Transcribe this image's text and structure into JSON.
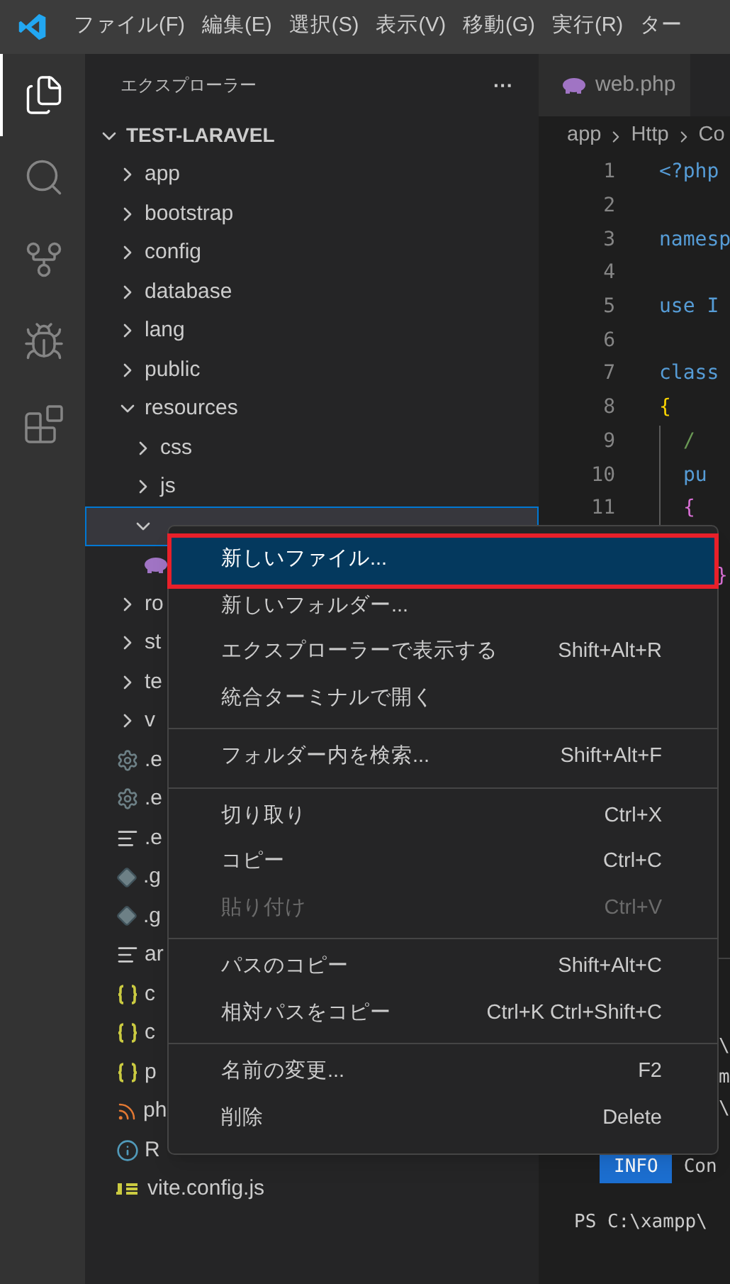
{
  "menu_bar": {
    "items": [
      "ファイル(F)",
      "編集(E)",
      "選択(S)",
      "表示(V)",
      "移動(G)",
      "実行(R)",
      "ター"
    ]
  },
  "activity_bar": {
    "items": [
      {
        "kind": "files",
        "selected": true
      },
      {
        "kind": "search",
        "selected": false
      },
      {
        "kind": "branch",
        "selected": false
      },
      {
        "kind": "debug",
        "selected": false
      },
      {
        "kind": "extensions",
        "selected": false
      }
    ]
  },
  "explorer": {
    "title": "エクスプローラー",
    "more": "···",
    "tree": [
      {
        "label": "TEST-LARAVEL",
        "kind": "root",
        "expanded": true,
        "children": [
          {
            "label": "app",
            "kind": "folder",
            "expanded": false
          },
          {
            "label": "bootstrap",
            "kind": "folder",
            "expanded": false
          },
          {
            "label": "config",
            "kind": "folder",
            "expanded": false
          },
          {
            "label": "database",
            "kind": "folder",
            "expanded": false
          },
          {
            "label": "lang",
            "kind": "folder",
            "expanded": false
          },
          {
            "label": "public",
            "kind": "folder",
            "expanded": false
          },
          {
            "label": "resources",
            "kind": "folder",
            "expanded": true,
            "children": [
              {
                "label": "css",
                "kind": "folder",
                "expanded": false
              },
              {
                "label": "js",
                "kind": "folder",
                "expanded": false
              },
              {
                "kind": "folder",
                "expanded": true,
                "selected": true,
                "children": [
                  {
                    "kind": "php"
                  }
                ]
              }
            ]
          },
          {
            "label": "ro",
            "kind": "folder",
            "expanded": false
          },
          {
            "label": "st",
            "kind": "folder",
            "expanded": false
          },
          {
            "label": "te",
            "kind": "folder",
            "expanded": false
          },
          {
            "label": "v",
            "kind": "folder",
            "expanded": false
          },
          {
            "label": ".e",
            "kind": "gear"
          },
          {
            "label": ".e",
            "kind": "gear"
          },
          {
            "label": ".e",
            "kind": "lines"
          },
          {
            "label": ".g",
            "kind": "git"
          },
          {
            "label": ".g",
            "kind": "git"
          },
          {
            "label": "ar",
            "kind": "lines"
          },
          {
            "label": "c",
            "kind": "json"
          },
          {
            "label": "c",
            "kind": "json"
          },
          {
            "label": "p",
            "kind": "json"
          },
          {
            "label": "ph",
            "kind": "rss"
          },
          {
            "label": "R",
            "kind": "info"
          },
          {
            "label": "vite.config.js",
            "kind": "js"
          }
        ]
      }
    ]
  },
  "editor": {
    "tab": {
      "label": "web.php"
    },
    "breadcrumbs": [
      "app",
      "Http",
      "Co"
    ],
    "lines": [
      {
        "number": "1",
        "code": "<?php",
        "color": "#569cd6"
      },
      {
        "number": "2"
      },
      {
        "number": "3",
        "code": "namesp",
        "color": "#569cd6"
      },
      {
        "number": "4"
      },
      {
        "number": "5",
        "code": "use I",
        "color": "#569cd6"
      },
      {
        "number": "6"
      },
      {
        "number": "7",
        "code": "class",
        "color": "#569cd6"
      },
      {
        "number": "8",
        "code": "{",
        "color": "#ffd700"
      },
      {
        "number": "9",
        "code": "/",
        "color": "#6a9955",
        "indent": true
      },
      {
        "number": "10",
        "code": "pu",
        "color": "#569cd6",
        "indent": true
      },
      {
        "number": "11",
        "code": "{",
        "color": "#da70d6",
        "indent": true
      }
    ],
    "closing_brace": "}"
  },
  "terminal": {
    "edge_lines": [
      "\\",
      "m",
      "\\"
    ],
    "badge": "INFO",
    "badge_text": "Con",
    "prompt": "PS C:\\xampp\\"
  },
  "context_menu": {
    "groups": [
      [
        {
          "label": "新しいファイル...",
          "selected": true,
          "disabled": false
        },
        {
          "label": "新しいフォルダー...",
          "selected": false,
          "disabled": false
        },
        {
          "label": "エクスプローラーで表示する",
          "shortcut": "Shift+Alt+R",
          "selected": false,
          "disabled": false
        },
        {
          "label": "統合ターミナルで開く",
          "selected": false,
          "disabled": false
        }
      ],
      [
        {
          "label": "フォルダー内を検索...",
          "shortcut": "Shift+Alt+F",
          "selected": false,
          "disabled": false
        }
      ],
      [
        {
          "label": "切り取り",
          "shortcut": "Ctrl+X",
          "selected": false,
          "disabled": false
        },
        {
          "label": "コピー",
          "shortcut": "Ctrl+C",
          "selected": false,
          "disabled": false
        },
        {
          "label": "貼り付け",
          "shortcut": "Ctrl+V",
          "selected": false,
          "disabled": true
        }
      ],
      [
        {
          "label": "パスのコピー",
          "shortcut": "Shift+Alt+C",
          "selected": false,
          "disabled": false
        },
        {
          "label": "相対パスをコピー",
          "shortcut": "Ctrl+K Ctrl+Shift+C",
          "selected": false,
          "disabled": false
        }
      ],
      [
        {
          "label": "名前の変更...",
          "shortcut": "F2",
          "selected": false,
          "disabled": false
        },
        {
          "label": "削除",
          "shortcut": "Delete",
          "selected": false,
          "disabled": false
        }
      ]
    ]
  }
}
